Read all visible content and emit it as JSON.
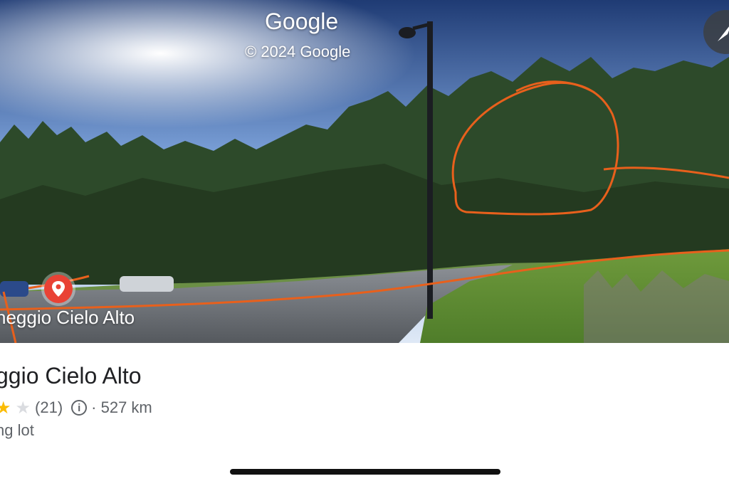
{
  "streetview": {
    "brand": "Google",
    "copyright": "© 2024 Google",
    "pin_label": "heggio Cielo Alto"
  },
  "place": {
    "title": "ggio Cielo Alto",
    "rating_count": "(21)",
    "distance": "· 527 km",
    "category": "ng lot",
    "stars": [
      {
        "glyph": "★",
        "state": "filled"
      },
      {
        "glyph": "★",
        "state": "empty"
      }
    ]
  },
  "icons": {
    "compass": "compass-icon",
    "info": "info-icon",
    "pin": "location-pin-icon"
  },
  "colors": {
    "annotation": "#e8601c",
    "pin": "#e94235",
    "star_filled": "#fbbc04",
    "star_empty": "#dadce0"
  }
}
